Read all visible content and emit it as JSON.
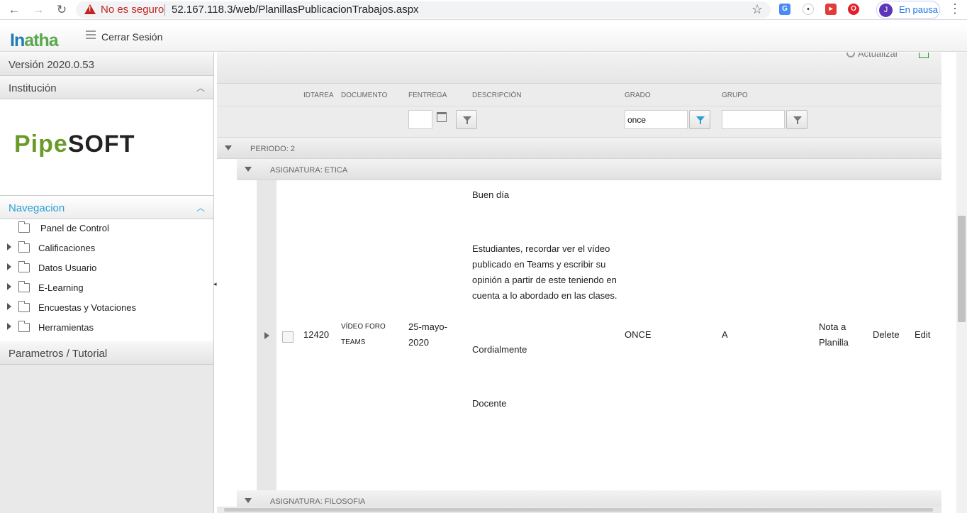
{
  "browser": {
    "security_label": "No es seguro",
    "url": "52.167.118.3/web/PlanillasPublicacionTrabajos.aspx",
    "profile_initial": "J",
    "profile_status": "En pausa"
  },
  "app": {
    "logo_part1": "In",
    "logo_part2": "atha",
    "logout_label": "Cerrar Sesión"
  },
  "sidebar": {
    "version": "Versión 2020.0.53",
    "institution_title": "Institución",
    "institution_logo_a": "Pipe",
    "institution_logo_b": "SOFT",
    "navigation_title": "Navegacion",
    "items": [
      {
        "label": "Panel de Control"
      },
      {
        "label": "Calificaciones"
      },
      {
        "label": "Datos Usuario"
      },
      {
        "label": "E-Learning"
      },
      {
        "label": "Encuestas y Votaciones"
      },
      {
        "label": "Herramientas"
      }
    ],
    "params_title": "Parametros / Tutorial"
  },
  "toolbar": {
    "refresh_label": "Actualizar"
  },
  "grid": {
    "columns": [
      "IDTAREA",
      "DOCUMENTO",
      "FENTREGA",
      "DESCRIPCIÓN",
      "GRADO",
      "GRUPO"
    ],
    "filters": {
      "fentrega": "",
      "grado": "once",
      "grupo": ""
    },
    "group_period": "PERIODO: 2",
    "group_subject_1": "ASIGNATURA: ETICA",
    "group_subject_2": "ASIGNATURA: FILOSOFIA",
    "row": {
      "idtarea": "12420",
      "documento_line1": "VÍDEO FORO",
      "documento_line2": "TEAMS",
      "fentrega_line1": "25-mayo-",
      "fentrega_line2": "2020",
      "descripcion": [
        "Buen día",
        "Estudiantes, recordar ver el vídeo publicado en Teams y escribir su opinión a partir de este teniendo en cuenta  a lo abordado en las clases.",
        "Cordialmente",
        "Docente"
      ],
      "grado": "ONCE",
      "grupo": "A",
      "action_grade_line1": "Nota a",
      "action_grade_line2": "Planilla",
      "action_delete": "Delete",
      "action_edit": "Edit"
    }
  },
  "colors": {
    "accent": "#2a9fd6",
    "insecure": "#c5221f"
  }
}
